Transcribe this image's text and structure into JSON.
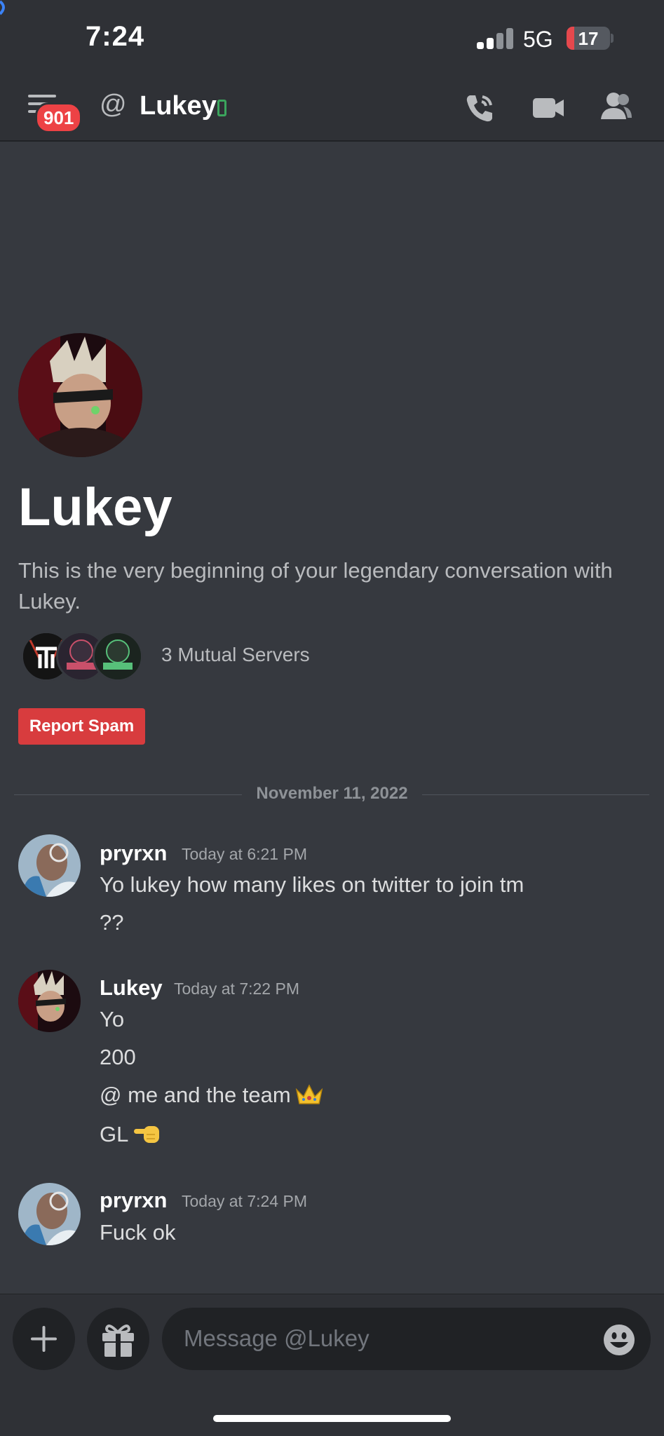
{
  "status": {
    "time": "7:24",
    "network": "5G",
    "battery": "17"
  },
  "header": {
    "badge_count": "901",
    "at_symbol": "@",
    "title": "Lukey"
  },
  "intro": {
    "name": "Lukey",
    "text": "This is the very beginning of your legendary conversation with Lukey.",
    "mutual_servers_label": "3 Mutual Servers",
    "report_button": "Report Spam"
  },
  "divider": {
    "date": "November 11, 2022"
  },
  "messages": [
    {
      "author": "pryrxn",
      "timestamp": "Today at 6:21 PM",
      "lines": [
        "Yo lukey how many likes on twitter to join tm",
        "??"
      ]
    },
    {
      "author": "Lukey",
      "timestamp": "Today at 7:22 PM",
      "lines": [
        "Yo",
        "200",
        "@ me and the team",
        "GL"
      ]
    },
    {
      "author": "pryrxn",
      "timestamp": "Today at 7:24 PM",
      "lines": [
        "Fuck ok"
      ]
    }
  ],
  "composer": {
    "placeholder": "Message @Lukey"
  },
  "icons": {
    "menu": "hamburger-menu-icon",
    "mobile": "mobile-status-icon",
    "call": "phone-call-icon",
    "video": "video-camera-icon",
    "members": "members-icon",
    "add": "plus-icon",
    "gift": "gift-icon",
    "emoji": "emoji-icon",
    "crown": "crown-emoji",
    "point": "pointing-hand-emoji"
  },
  "colors": {
    "background": "#36393f",
    "header": "#2f3136",
    "danger": "#ed4245",
    "online_mobile": "#3ba55d"
  }
}
